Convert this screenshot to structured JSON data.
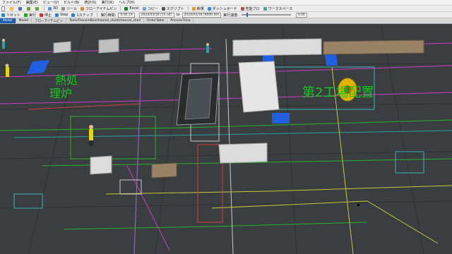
{
  "menu": [
    "ファイル(F)",
    "編集(E)",
    "ビュー(V)",
    "ビルド(B)",
    "統計(S)",
    "実行(R)",
    "ヘルプ(H)"
  ],
  "toolbar1": {
    "items": [
      "3D",
      "ツール",
      "フローアイテムビン",
      "Excel",
      "コピー",
      "スクリプト",
      "新規",
      "ダッシュボード",
      "性能ブロ",
      "ワークスペース"
    ]
  },
  "toolbar2": {
    "reset_label": "リセット",
    "run_label": "実行",
    "stop_label": "停止",
    "step_label": "Step",
    "jump_label": "1ステップ",
    "clock_label": "実行時間:",
    "run_time": "0:00:19",
    "start_date": "2024/03/18 [15:34]",
    "to_label": "to",
    "end_date": "2024/03/18 [9000.00]",
    "speed_label": "実行速度:",
    "speed_value": "4.00",
    "speed_level": 0.1
  },
  "tabs": [
    "Model",
    "Model",
    "フローアイテムビン",
    "Tools/FlexsimBin/channel_shell/channel_shell",
    "OrderTable",
    "ProcessTime"
  ],
  "scene": {
    "label_left_1": "熱処",
    "label_left_2": "理炉",
    "label_right": "第2工場配置"
  },
  "colors": {
    "floor": "#3b3e41",
    "accent_blue": "#1e5fb8",
    "zone_blue": "#1f5fe0",
    "label_green": "#14c81e",
    "machine_white": "#dcdcdc",
    "pallet_brown": "#9a8266",
    "reel_yellow": "#e0b400",
    "worker_yellow": "#e6d800"
  }
}
